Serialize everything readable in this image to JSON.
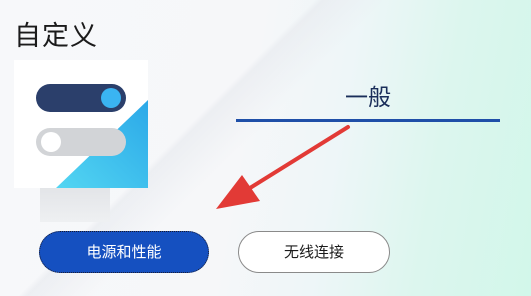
{
  "page": {
    "title": "自定义"
  },
  "tabs": {
    "general": "一般"
  },
  "buttons": {
    "power_performance": "电源和性能",
    "wireless_connection": "无线连接"
  },
  "colors": {
    "accent_blue": "#1550c0",
    "tab_underline": "#1f4fa8",
    "arrow_red": "#e23a36",
    "toggle_dark": "#2b3f6b",
    "toggle_knob_blue": "#3ab4f2",
    "illustration_cyan": "#3ec8f0"
  },
  "icons": {
    "illustration": "toggle-switches-illustration",
    "annotation": "red-arrow"
  },
  "toggles": {
    "top": {
      "state": "on"
    },
    "bottom": {
      "state": "off"
    }
  }
}
